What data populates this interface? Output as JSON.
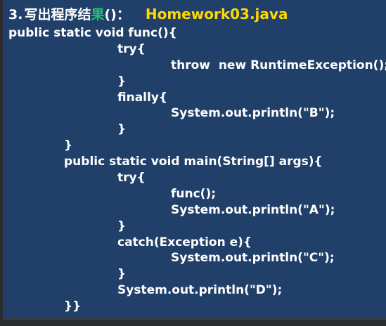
{
  "title": {
    "number": "3.",
    "chinese_before": "写出程序结",
    "chinese_highlight": "果",
    "chinese_after": "()：",
    "filename": "Homework03.java"
  },
  "code_lines": [
    "public static void func(){",
    "try{",
    "throw  new RuntimeException();",
    "}",
    "finally{",
    "System.out.println(\"B\");",
    "}",
    "}",
    "public static void main(String[] args){",
    "try{",
    "func();",
    "System.out.println(\"A\");",
    "}",
    "catch(Exception e){",
    "System.out.println(\"C\");",
    "}",
    "System.out.println(\"D\");",
    "}}"
  ],
  "colors": {
    "slide_background": "#20406a",
    "outer_background": "#2a2c2e",
    "code_text": "#ffffff",
    "filename_text": "#ffd700",
    "highlight_char": "#22c36a"
  }
}
